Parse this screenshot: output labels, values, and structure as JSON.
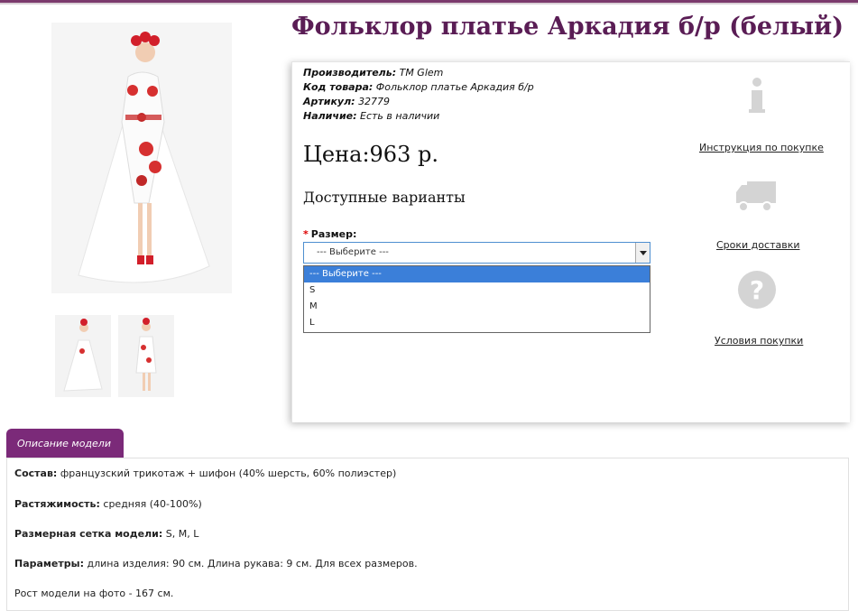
{
  "product": {
    "title": "Фольклор платье Аркадия б/р (белый)",
    "meta": [
      {
        "label": "Производитель:",
        "value": "TM Glem"
      },
      {
        "label": "Код товара:",
        "value": "Фольклор платье Аркадия б/р"
      },
      {
        "label": "Артикул:",
        "value": "32779"
      },
      {
        "label": "Наличие:",
        "value": "Есть в наличии"
      }
    ],
    "price": "Цена:963 р.",
    "variants_heading": "Доступные варианты",
    "size_label": "Размер:",
    "size_required_mark": "*",
    "size_select_value": "--- Выберите ---",
    "size_options": [
      "--- Выберите ---",
      "S",
      "M",
      "L"
    ]
  },
  "side_links": {
    "instruction": "Инструкция по покупке",
    "delivery": "Сроки доставки",
    "conditions": "Условия покупки"
  },
  "tabs": {
    "description": "Описание модели"
  },
  "description": [
    {
      "label": "Состав:",
      "value": "французский трикотаж + шифон (40% шерсть, 60% полиэстер)"
    },
    {
      "label": "Растяжимость:",
      "value": "средняя (40-100%)"
    },
    {
      "label": "Размерная сетка модели:",
      "value": "S, M, L"
    },
    {
      "label": "Параметры:",
      "value": "длина изделия: 90 см. Длина рукава: 9 см. Для всех размеров."
    },
    {
      "label": "",
      "value": "Рост модели на фото - 167 см."
    }
  ],
  "colors": {
    "accent": "#7b2a79",
    "title": "#5a1d55",
    "selected_option": "#3b7fd9"
  }
}
